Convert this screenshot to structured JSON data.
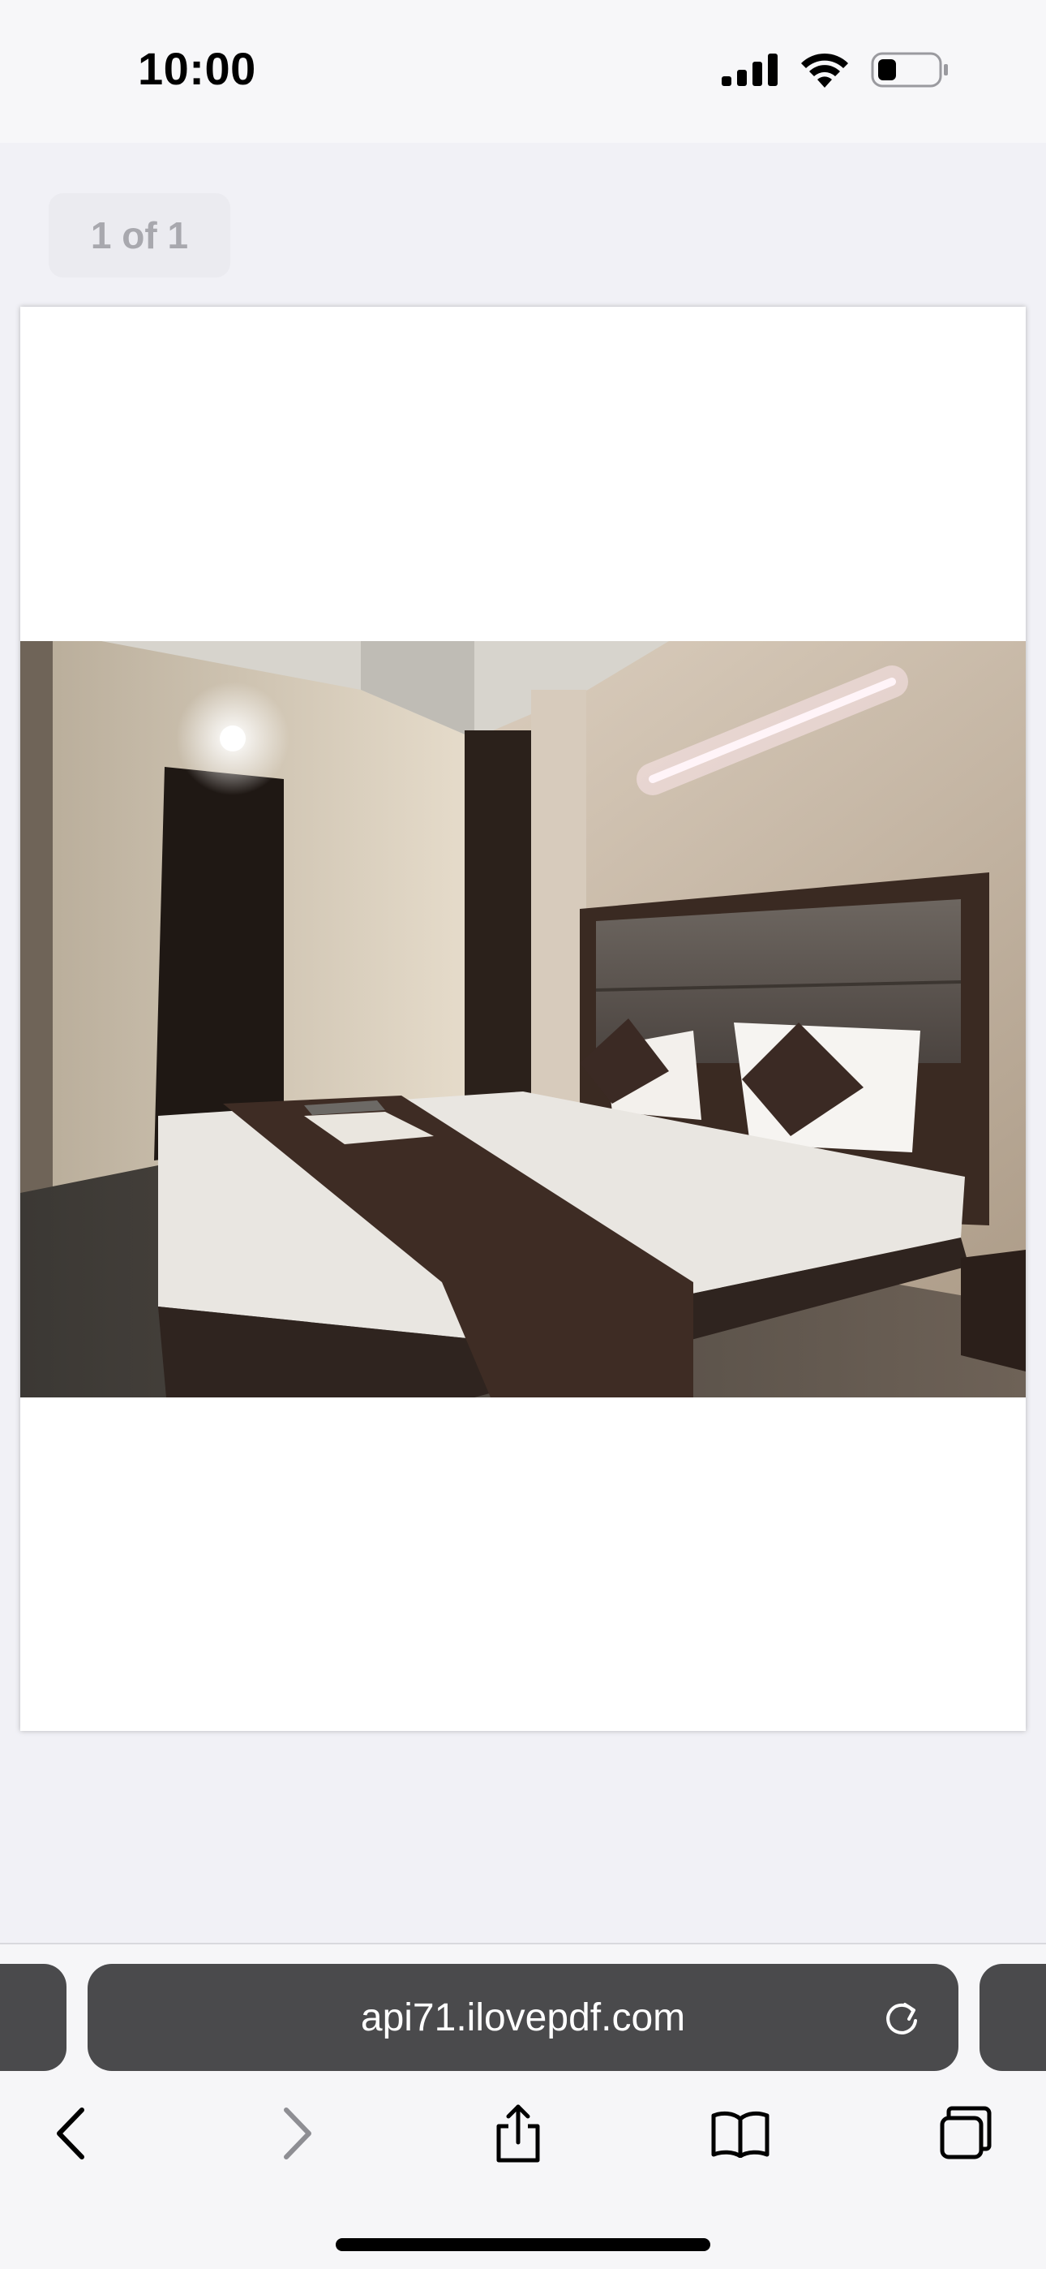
{
  "status_bar": {
    "time": "10:00",
    "icons": [
      "signal-icon",
      "wifi-icon",
      "battery-icon"
    ]
  },
  "viewer": {
    "page_counter": "1 of 1",
    "page_content": "photo of a hotel room with a double bed"
  },
  "browser": {
    "url": "api71.ilovepdf.com",
    "address_bar_icon": "reload-icon",
    "toolbar": [
      "back-icon",
      "forward-icon",
      "share-icon",
      "bookmarks-icon",
      "tabs-icon"
    ]
  },
  "colors": {
    "background": "#f1f1f6",
    "address_bar": "#4a4a4c",
    "toolbar_icon": "#000000",
    "toolbar_icon_disabled": "#8e8e93",
    "page_counter_text": "#a8a8ae"
  }
}
